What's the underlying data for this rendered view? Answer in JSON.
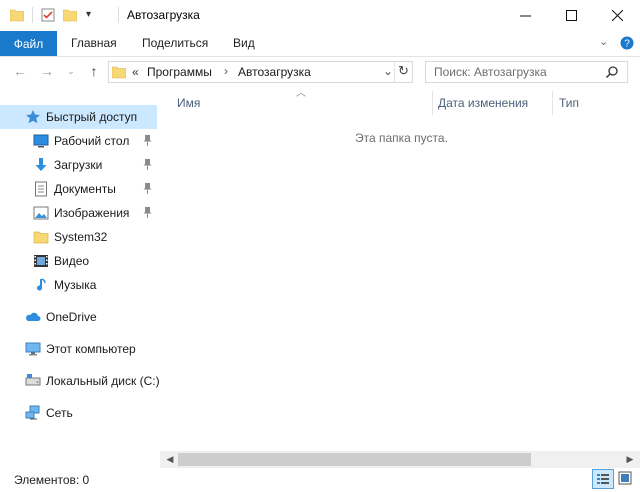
{
  "window": {
    "title": "Автозагрузка",
    "minimize_icon": "minimize-icon",
    "maximize_icon": "maximize-icon",
    "close_icon": "close-icon"
  },
  "ribbon": {
    "tabs": [
      {
        "label": "Файл",
        "active": true
      },
      {
        "label": "Главная"
      },
      {
        "label": "Поделиться"
      },
      {
        "label": "Вид"
      }
    ],
    "accent": "#1979ca"
  },
  "address_bar": {
    "overflow": "«",
    "crumbs": [
      "Программы",
      "Автозагрузка"
    ]
  },
  "search": {
    "placeholder": "Поиск: Автозагрузка"
  },
  "nav": {
    "quick_access": "Быстрый доступ",
    "items": [
      {
        "label": "Рабочий стол",
        "pinned": true,
        "icon": "desktop-icon"
      },
      {
        "label": "Загрузки",
        "pinned": true,
        "icon": "download-icon"
      },
      {
        "label": "Документы",
        "pinned": true,
        "icon": "documents-icon"
      },
      {
        "label": "Изображения",
        "pinned": true,
        "icon": "pictures-icon"
      },
      {
        "label": "System32",
        "pinned": false,
        "icon": "folder-icon"
      },
      {
        "label": "Видео",
        "pinned": false,
        "icon": "video-icon"
      },
      {
        "label": "Музыка",
        "pinned": false,
        "icon": "music-icon"
      }
    ],
    "onedrive": "OneDrive",
    "this_pc": "Этот компьютер",
    "local_disk": "Локальный диск (C:)",
    "network": "Сеть"
  },
  "content": {
    "columns": [
      "Имя",
      "Дата изменения",
      "Тип"
    ],
    "empty_text": "Эта папка пуста."
  },
  "status": {
    "items": "Элементов: 0"
  }
}
